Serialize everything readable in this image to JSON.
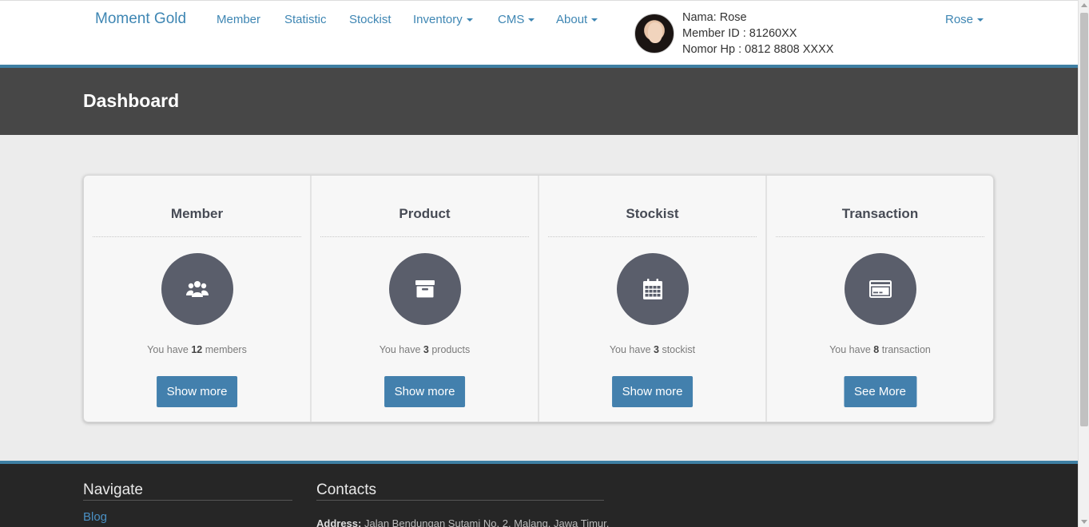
{
  "navbar": {
    "brand": "Moment Gold",
    "links": [
      {
        "label": "Member",
        "dropdown": false
      },
      {
        "label": "Statistic",
        "dropdown": false
      },
      {
        "label": "Stockist",
        "dropdown": false
      },
      {
        "label": "Inventory",
        "dropdown": true
      },
      {
        "label": "CMS",
        "dropdown": true
      },
      {
        "label": "About",
        "dropdown": true
      }
    ],
    "user": {
      "name_line": "Nama: Rose",
      "member_id_line": "Member ID : 81260XX",
      "phone_line": "Nomor Hp : 0812 8808 XXXX",
      "menu_label": "Rose"
    }
  },
  "header": {
    "title": "Dashboard"
  },
  "cards": [
    {
      "title": "Member",
      "icon": "users-icon",
      "prefix": "You have",
      "count": "12",
      "suffix": "members",
      "button": "Show more"
    },
    {
      "title": "Product",
      "icon": "archive-box-icon",
      "prefix": "You have",
      "count": "3",
      "suffix": "products",
      "button": "Show more"
    },
    {
      "title": "Stockist",
      "icon": "calendar-icon",
      "prefix": "You have",
      "count": "3",
      "suffix": "stockist",
      "button": "Show more"
    },
    {
      "title": "Transaction",
      "icon": "credit-card-icon",
      "prefix": "You have",
      "count": "8",
      "suffix": "transaction",
      "button": "See More"
    }
  ],
  "footer": {
    "navigate_heading": "Navigate",
    "navigate_links": [
      "Blog"
    ],
    "contacts_heading": "Contacts",
    "address_label": "Address:",
    "address_value": "Jalan Bendungan Sutami No. 2, Malang, Jawa Timur,"
  },
  "colors": {
    "accent": "#3e86b3",
    "button": "#4380ad",
    "header_band": "#474747",
    "icon_circle": "#5a5e6b",
    "footer_bg": "#262626"
  }
}
